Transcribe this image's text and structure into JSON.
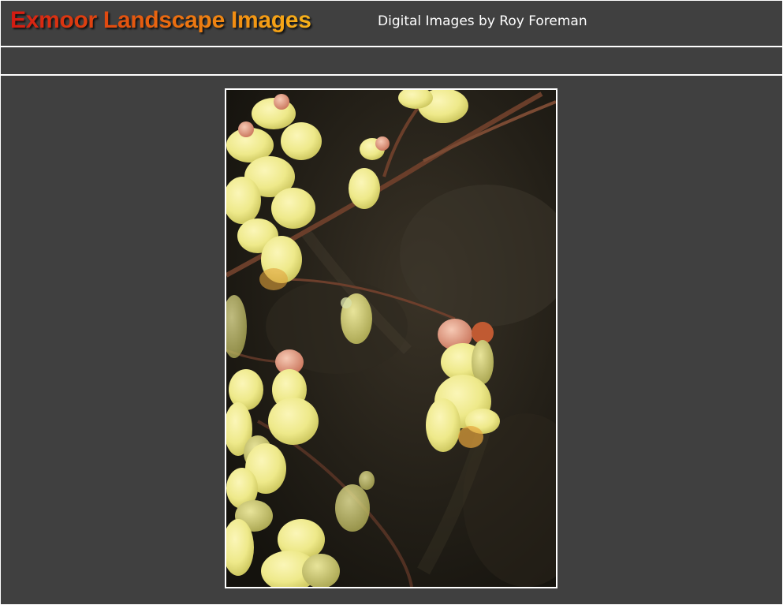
{
  "header": {
    "site_title": "Exmoor Landscape Images",
    "tagline": "Digital Images by Roy Foreman"
  },
  "photo": {
    "subject": "yellow-flower-blossoms-photo"
  },
  "colors": {
    "background": "#404040",
    "rule": "#ffffff",
    "title_gradient_start": "#d41a12",
    "title_gradient_end": "#f7b21a"
  }
}
